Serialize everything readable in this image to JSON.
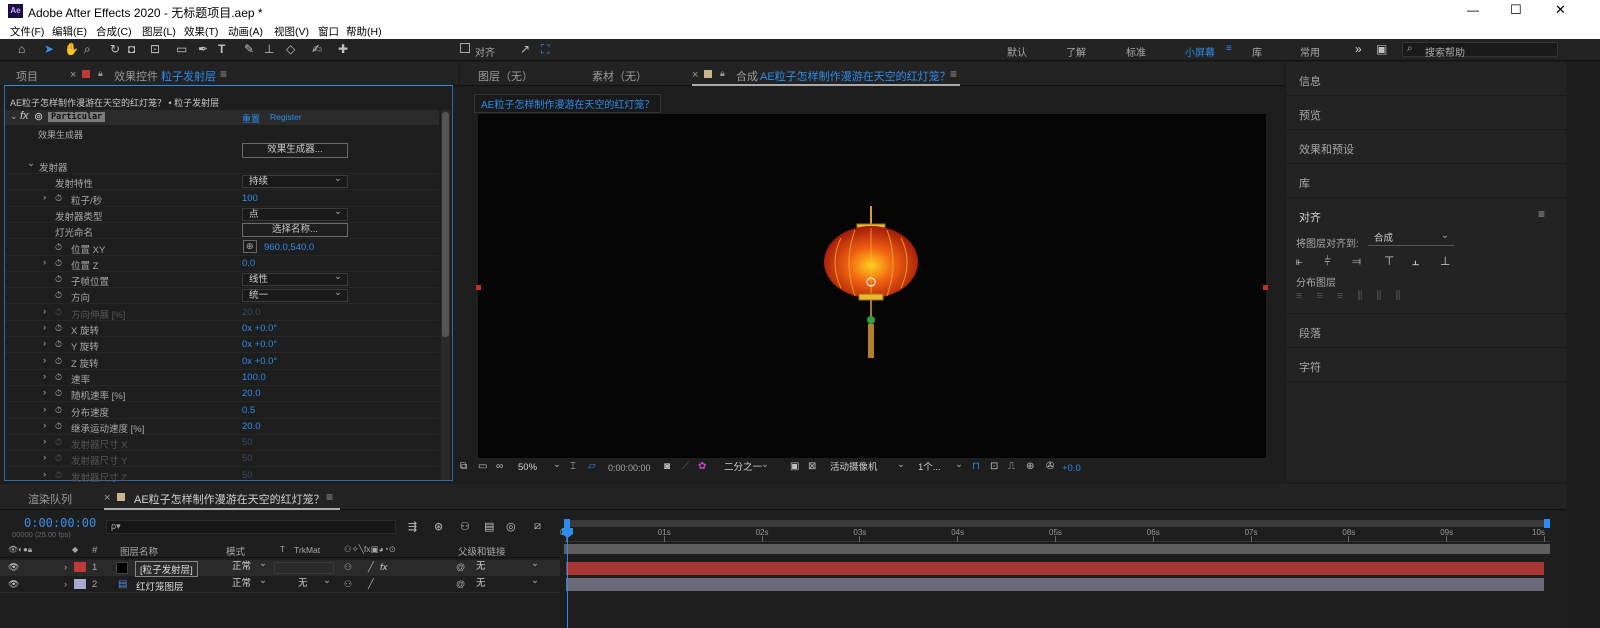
{
  "app": {
    "icon": "Ae",
    "title": "Adobe After Effects 2020 - 无标题项目.aep *",
    "win": {
      "min": "—",
      "max": "☐",
      "close": "✕"
    }
  },
  "menu": [
    "文件(F)",
    "编辑(E)",
    "合成(C)",
    "图层(L)",
    "效果(T)",
    "动画(A)",
    "视图(V)",
    "窗口",
    "帮助(H)"
  ],
  "toolbar": {
    "align": "对齐",
    "workspaces": [
      "默认",
      "了解",
      "标准",
      "小屏幕",
      "库",
      "常用"
    ],
    "active_ws": "小屏幕",
    "search": "搜索帮助",
    "more": "»"
  },
  "left": {
    "tab_project": "项目",
    "tab_effects_prefix": "效果控件",
    "tab_effects_layer": "粒子发射层",
    "breadcrumb": "AE粒子怎样制作漫游在天空的红灯笼？ • 粒子发射层",
    "fx_name": "Particular",
    "reset": "重置",
    "register": "Register",
    "gen_label": "效果生成器",
    "gen_btn": "效果生成器...",
    "rows": [
      {
        "label": "发射器",
        "indent": 1,
        "tw": "open"
      },
      {
        "label": "发射特性",
        "indent": 3,
        "dd": "持续"
      },
      {
        "label": "粒子/秒",
        "indent": 3,
        "tw": "closed",
        "sw": 1,
        "val": "100"
      },
      {
        "label": "发射器类型",
        "indent": 3,
        "dd": "点"
      },
      {
        "label": "灯光命名",
        "indent": 3,
        "btn": "选择名称..."
      },
      {
        "label": "位置 XY",
        "indent": 3,
        "sw": 1,
        "val": "960.0,540.0",
        "pos": 1
      },
      {
        "label": "位置 Z",
        "indent": 3,
        "tw": "closed",
        "sw": 1,
        "val": "0.0"
      },
      {
        "label": "子帧位置",
        "indent": 3,
        "sw": 1,
        "dd": "线性"
      },
      {
        "label": "方向",
        "indent": 3,
        "sw": 1,
        "dd": "统一"
      },
      {
        "label": "方向伸展 [%]",
        "indent": 3,
        "tw": "closed",
        "sw": 1,
        "val": "20.0",
        "dim": 1
      },
      {
        "label": "X 旋转",
        "indent": 3,
        "tw": "closed",
        "sw": 1,
        "val": "0x +0.0°"
      },
      {
        "label": "Y 旋转",
        "indent": 3,
        "tw": "closed",
        "sw": 1,
        "val": "0x +0.0°"
      },
      {
        "label": "Z 旋转",
        "indent": 3,
        "tw": "closed",
        "sw": 1,
        "val": "0x +0.0°"
      },
      {
        "label": "速率",
        "indent": 3,
        "tw": "closed",
        "sw": 1,
        "val": "100.0"
      },
      {
        "label": "随机速率 [%]",
        "indent": 3,
        "tw": "closed",
        "sw": 1,
        "val": "20.0"
      },
      {
        "label": "分布速度",
        "indent": 3,
        "tw": "closed",
        "sw": 1,
        "val": "0.5"
      },
      {
        "label": "继承运动速度 [%]",
        "indent": 3,
        "tw": "closed",
        "sw": 1,
        "val": "20.0"
      },
      {
        "label": "发射器尺寸 X",
        "indent": 3,
        "tw": "closed",
        "sw": 1,
        "val": "50",
        "dim": 1
      },
      {
        "label": "发射器尺寸 Y",
        "indent": 3,
        "tw": "closed",
        "sw": 1,
        "val": "50",
        "dim": 1
      },
      {
        "label": "发射器尺寸 Z",
        "indent": 3,
        "tw": "closed",
        "sw": 1,
        "val": "50",
        "dim": 1
      }
    ]
  },
  "center": {
    "tab_layer": "图层（无）",
    "tab_footage": "素材（无）",
    "tab_comp_prefix": "合成",
    "tab_comp_name": "AE粒子怎样制作漫游在天空的红灯笼？",
    "comp_label": "AE粒子怎样制作漫游在天空的红灯笼？",
    "zoom": "50%",
    "time": "0:00:00:00",
    "res": "二分之一",
    "camera": "活动摄像机",
    "views": "1个...",
    "exposure": "+0.0"
  },
  "right": [
    "信息",
    "预览",
    "效果和预设",
    "库",
    "对齐",
    "段落",
    "字符"
  ],
  "align": {
    "label": "将图层对齐到:",
    "target": "合成",
    "dist": "分布图层"
  },
  "timeline": {
    "tab_render": "渲染队列",
    "tab_comp": "AE粒子怎样制作漫游在天空的红灯笼？",
    "timecode": "0:00:00:00",
    "timecode_sub": "00000 (25.00 fps)",
    "search_placeholder": "ρ▾",
    "headers": {
      "name": "图层名称",
      "mode": "模式",
      "t": "T",
      "trk": "TrkMat",
      "parent": "父级和链接"
    },
    "layers": [
      {
        "num": "1",
        "name": "[粒子发射层]",
        "mode": "正常",
        "trk": "",
        "parent": "无",
        "color": "#c03a3a"
      },
      {
        "num": "2",
        "name": "红灯笼图层",
        "mode": "正常",
        "trk": "无",
        "parent": "无",
        "color": "#a8a8c8"
      }
    ],
    "ruler": [
      "0s",
      "01s",
      "02s",
      "03s",
      "04s",
      "05s",
      "06s",
      "07s",
      "08s",
      "09s",
      "10s"
    ]
  }
}
